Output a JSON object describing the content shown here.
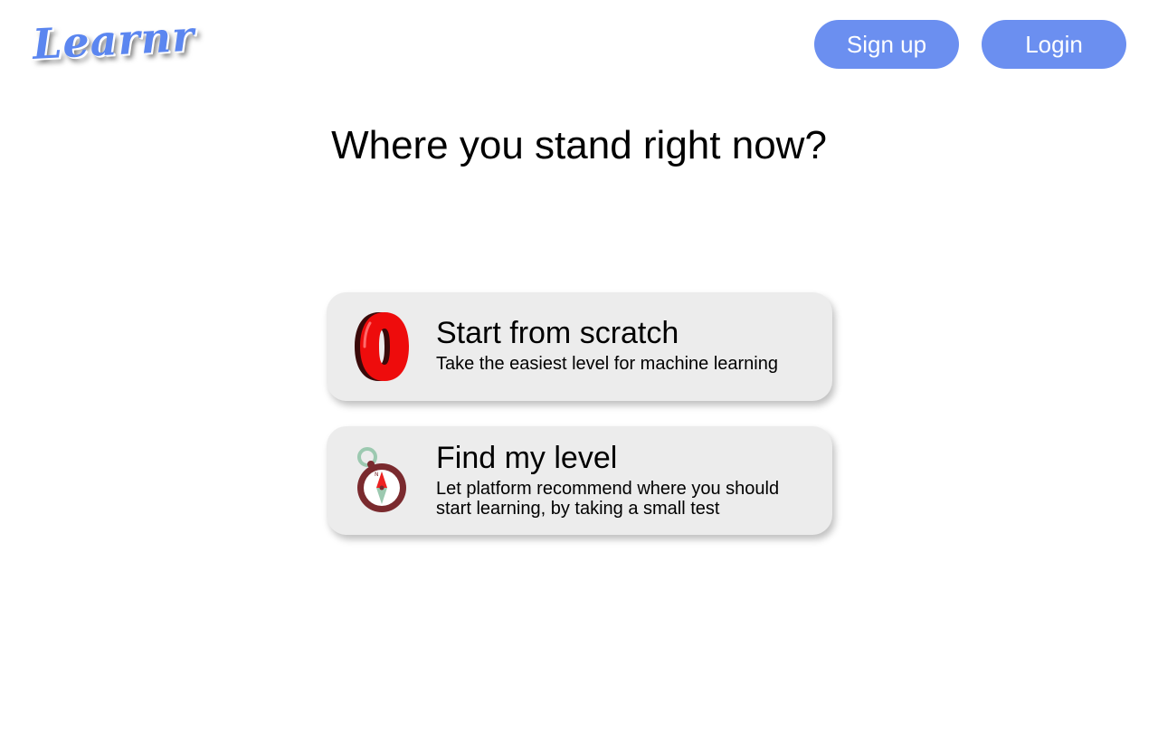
{
  "brand": {
    "logo_text": "Learnr",
    "accent_color": "#6b8ff0"
  },
  "header": {
    "signup_label": "Sign up",
    "login_label": "Login"
  },
  "main": {
    "title": "Where you stand right now?",
    "options": [
      {
        "icon": "zero-icon",
        "title": "Start from scratch",
        "description": "Take the easiest level for machine learning"
      },
      {
        "icon": "compass-icon",
        "title": "Find my level",
        "description": "Let platform recommend where you should start learning, by taking a small test"
      }
    ]
  }
}
